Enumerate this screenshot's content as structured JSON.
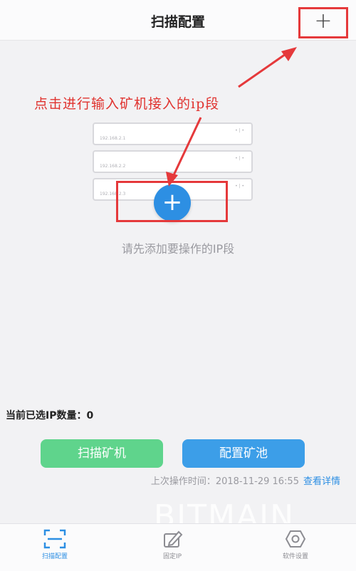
{
  "header": {
    "title": "扫描配置",
    "add_symbol": "+"
  },
  "annotation": {
    "text": "点击进行输入矿机接入的ip段"
  },
  "illustration": {
    "cards": [
      {
        "ip": "192.168.2.1",
        "dots": "• | •"
      },
      {
        "ip": "192.168.2.2",
        "dots": "• | •"
      },
      {
        "ip": "192.168.2.3",
        "dots": "• | •"
      }
    ],
    "plus_symbol": "+"
  },
  "empty_hint": "请先添加要操作的IP段",
  "selected_count": "当前已选IP数量：0",
  "actions": {
    "scan_label": "扫描矿机",
    "pool_label": "配置矿池"
  },
  "last_op": {
    "text": "上次操作时间：2018-11-29 16:55",
    "link": "查看详情"
  },
  "watermark": "BITMAIN",
  "tabs": [
    {
      "label": "扫描配置",
      "icon": "scan-icon",
      "active": true
    },
    {
      "label": "固定IP",
      "icon": "edit-icon",
      "active": false
    },
    {
      "label": "软件设置",
      "icon": "settings-icon",
      "active": false
    }
  ],
  "colors": {
    "accent": "#2d8fe3",
    "annotation": "#e0332f",
    "scan_button": "#5fd48c",
    "pool_button": "#3c9ee8"
  }
}
